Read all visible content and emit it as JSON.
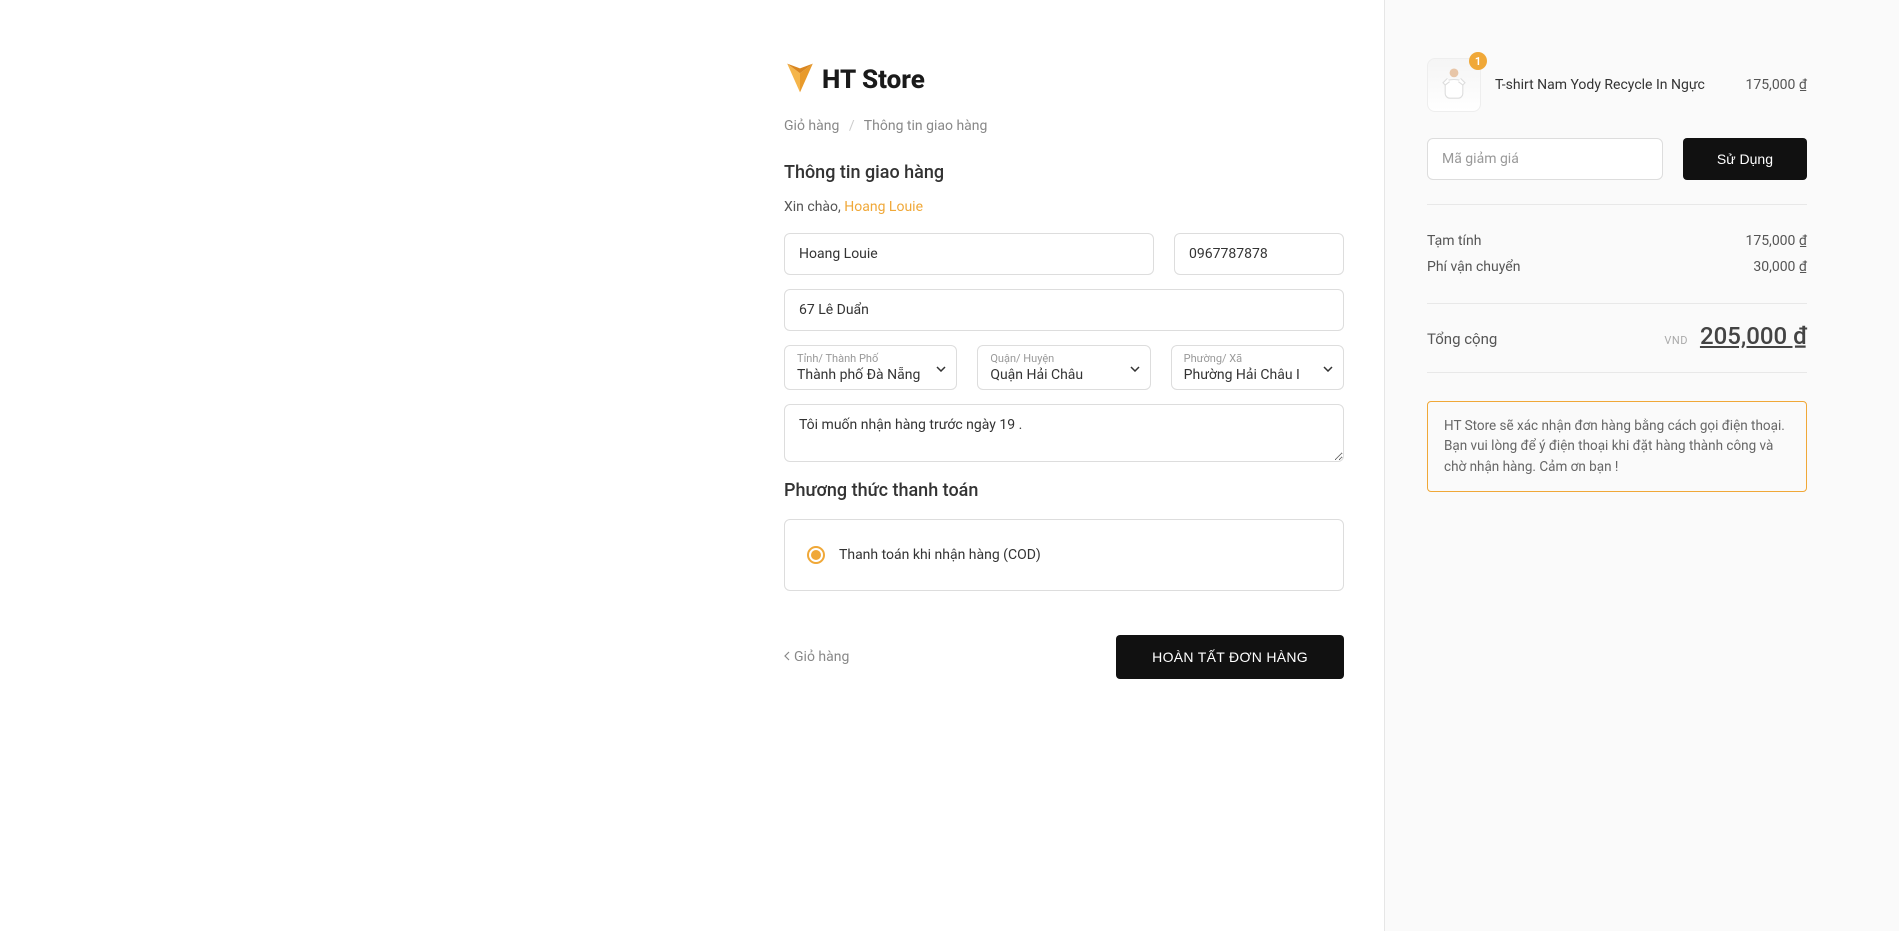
{
  "logo": {
    "text": "HT Store"
  },
  "breadcrumb": {
    "cart": "Giỏ hàng",
    "current": "Thông tin giao hàng"
  },
  "shipping": {
    "title": "Thông tin giao hàng",
    "greeting_prefix": "Xin chào, ",
    "user_name": "Hoang Louie",
    "name_value": "Hoang Louie",
    "phone_value": "0967787878",
    "address_value": "67 Lê Duẩn",
    "province_label": "Tỉnh/ Thành Phố",
    "province_value": "Thành phố Đà Nẵng",
    "district_label": "Quận/ Huyện",
    "district_value": "Quận Hải Châu",
    "ward_label": "Phường/ Xã",
    "ward_value": "Phường Hải Châu I",
    "note_value": "Tôi muốn nhận hàng trước ngày 19 . "
  },
  "payment": {
    "title": "Phương thức thanh toán",
    "cod_label": "Thanh toán khi nhận hàng (COD)"
  },
  "actions": {
    "back_label": "Giỏ hàng",
    "submit_label": "HOÀN TẤT ĐƠN HÀNG"
  },
  "cart": {
    "items": [
      {
        "qty": "1",
        "name": "T-shirt Nam Yody Recycle In Ngực",
        "price": "175,000 ₫"
      }
    ],
    "coupon_placeholder": "Mã giảm giá",
    "apply_label": "Sử Dụng",
    "subtotal_label": "Tạm tính",
    "subtotal_value": "175,000 ₫",
    "shipping_label": "Phí vận chuyển",
    "shipping_value": "30,000 ₫",
    "total_label": "Tổng cộng",
    "total_currency": "VND",
    "total_value": "205,000 ₫"
  },
  "notice": "HT Store sẽ xác nhận đơn hàng bằng cách gọi điện thoại. Bạn vui lòng để ý điện thoại khi đặt hàng thành công và chờ nhận hàng. Cảm ơn bạn !"
}
